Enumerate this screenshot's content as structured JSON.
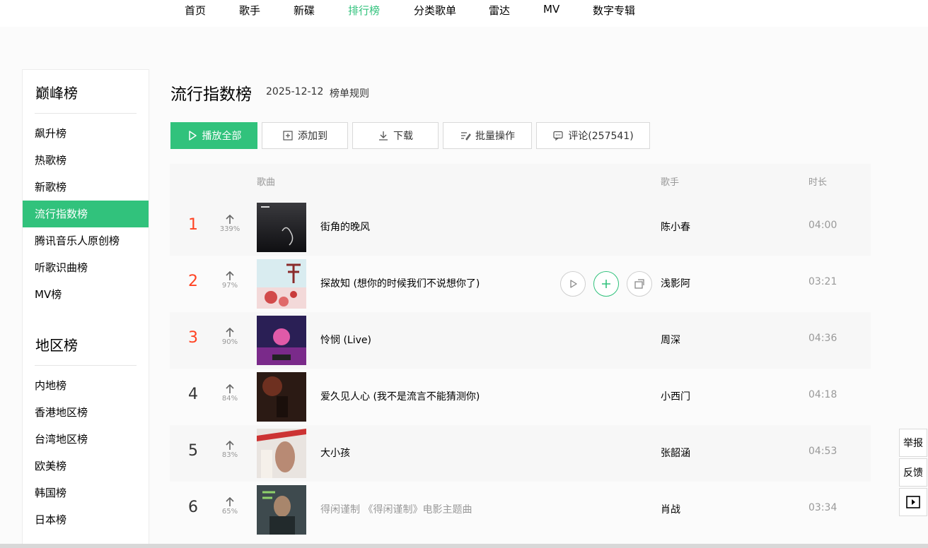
{
  "nav": [
    "首页",
    "歌手",
    "新碟",
    "排行榜",
    "分类歌单",
    "雷达",
    "MV",
    "数字专辑"
  ],
  "sidebar": {
    "group1": "巅峰榜",
    "group1_items": [
      "飙升榜",
      "热歌榜",
      "新歌榜",
      "流行指数榜",
      "腾讯音乐人原创榜",
      "听歌识曲榜",
      "MV榜"
    ],
    "group2": "地区榜",
    "group2_items": [
      "内地榜",
      "香港地区榜",
      "台湾地区榜",
      "欧美榜",
      "韩国榜",
      "日本榜"
    ],
    "active": "流行指数榜"
  },
  "header": {
    "title": "流行指数榜",
    "date": "2025-12-12",
    "rules": "榜单规则"
  },
  "toolbar": {
    "play_all": "播放全部",
    "add_to": "添加到",
    "download": "下载",
    "batch": "批量操作",
    "comments": "评论(257541)"
  },
  "table": {
    "col_song": "歌曲",
    "col_singer": "歌手",
    "col_duration": "时长",
    "rows": [
      {
        "rank": "1",
        "trend": "339%",
        "title": "街角的晚风",
        "singer": "陈小春",
        "duration": "04:00"
      },
      {
        "rank": "2",
        "trend": "97%",
        "title": "探故知 (想你的时候我们不说想你了)",
        "singer": "浅影阿",
        "duration": "03:21"
      },
      {
        "rank": "3",
        "trend": "90%",
        "title": "怜悯 (Live)",
        "singer": "周深",
        "duration": "04:36"
      },
      {
        "rank": "4",
        "trend": "84%",
        "title": "爱久见人心 (我不是流言不能猜测你)",
        "singer": "小西门",
        "duration": "04:18"
      },
      {
        "rank": "5",
        "trend": "83%",
        "title": "大小孩",
        "singer": "张韶涵",
        "duration": "04:53"
      },
      {
        "rank": "6",
        "trend": "65%",
        "title": "得闲谨制 《得闲谨制》电影主题曲",
        "singer": "肖战",
        "duration": "03:34"
      }
    ]
  },
  "side_widgets": {
    "report": "举报",
    "feedback": "反馈"
  },
  "colors": {
    "accent": "#31c27c",
    "rank_top": "#ff4222"
  }
}
